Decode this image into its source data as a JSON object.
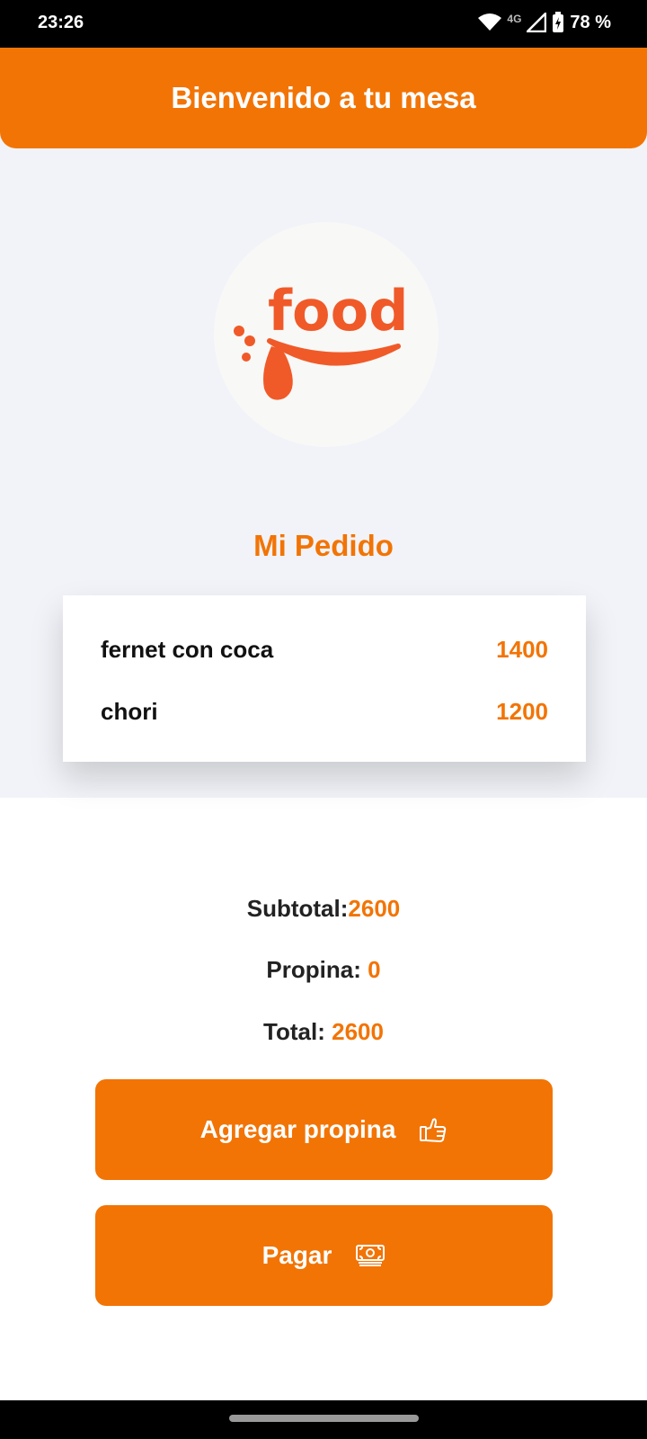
{
  "status_bar": {
    "time": "23:26",
    "network": "4G",
    "battery": "78 %",
    "icons": [
      "wifi-icon",
      "cell-signal-icon",
      "battery-charging-icon"
    ]
  },
  "header": {
    "title": "Bienvenido a tu mesa"
  },
  "logo": {
    "text": "food",
    "color": "#f05a28"
  },
  "order": {
    "title": "Mi Pedido",
    "items": [
      {
        "name": "fernet con coca",
        "price": "1400"
      },
      {
        "name": "chori",
        "price": "1200"
      }
    ]
  },
  "summary": {
    "subtotal_label": "Subtotal:",
    "subtotal_value": "2600",
    "tip_label": "Propina: ",
    "tip_value": "0",
    "total_label": "Total: ",
    "total_value": "2600"
  },
  "actions": {
    "add_tip_label": "Agregar propina",
    "add_tip_icon": "thumbs-up-icon",
    "pay_label": "Pagar",
    "pay_icon": "money-icon"
  },
  "colors": {
    "accent": "#f27405",
    "background": "#f1f3f8"
  }
}
